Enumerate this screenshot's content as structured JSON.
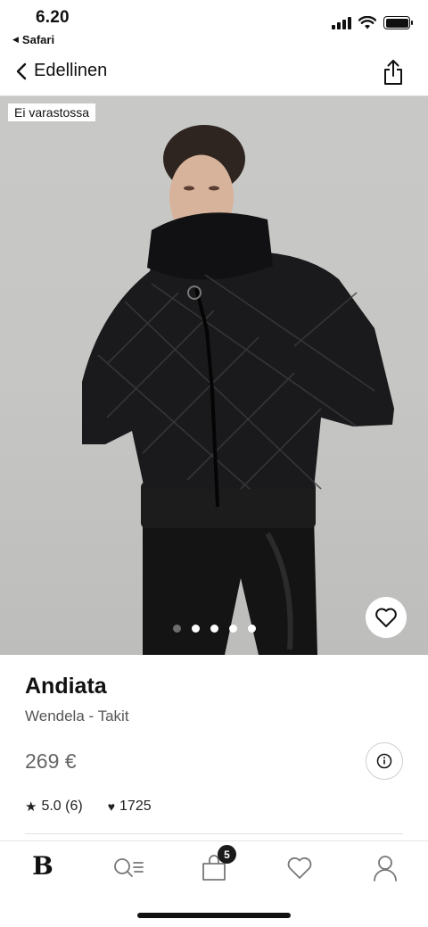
{
  "status_bar": {
    "time": "6.20",
    "back_app": "Safari"
  },
  "nav": {
    "back_label": "Edellinen",
    "share_icon": "share-icon"
  },
  "hero": {
    "stock_badge": "Ei varastossa",
    "image_count": 5,
    "active_image_index": 0,
    "favorite_icon": "heart-outline-icon"
  },
  "product": {
    "name": "Andiata",
    "subtitle": "Wendela - Takit",
    "price": "269 €",
    "rating": "5.0 (6)",
    "likes": "1725",
    "info_icon": "info-icon"
  },
  "tab_bar": {
    "logo": "B",
    "cart_count": "5",
    "tabs": [
      "home-logo",
      "search-menu-icon",
      "shopping-bag-icon",
      "heart-icon",
      "user-icon"
    ]
  },
  "colors": {
    "accent": "#111111",
    "muted_text": "#555555",
    "hero_background": "#c6c6c4"
  }
}
